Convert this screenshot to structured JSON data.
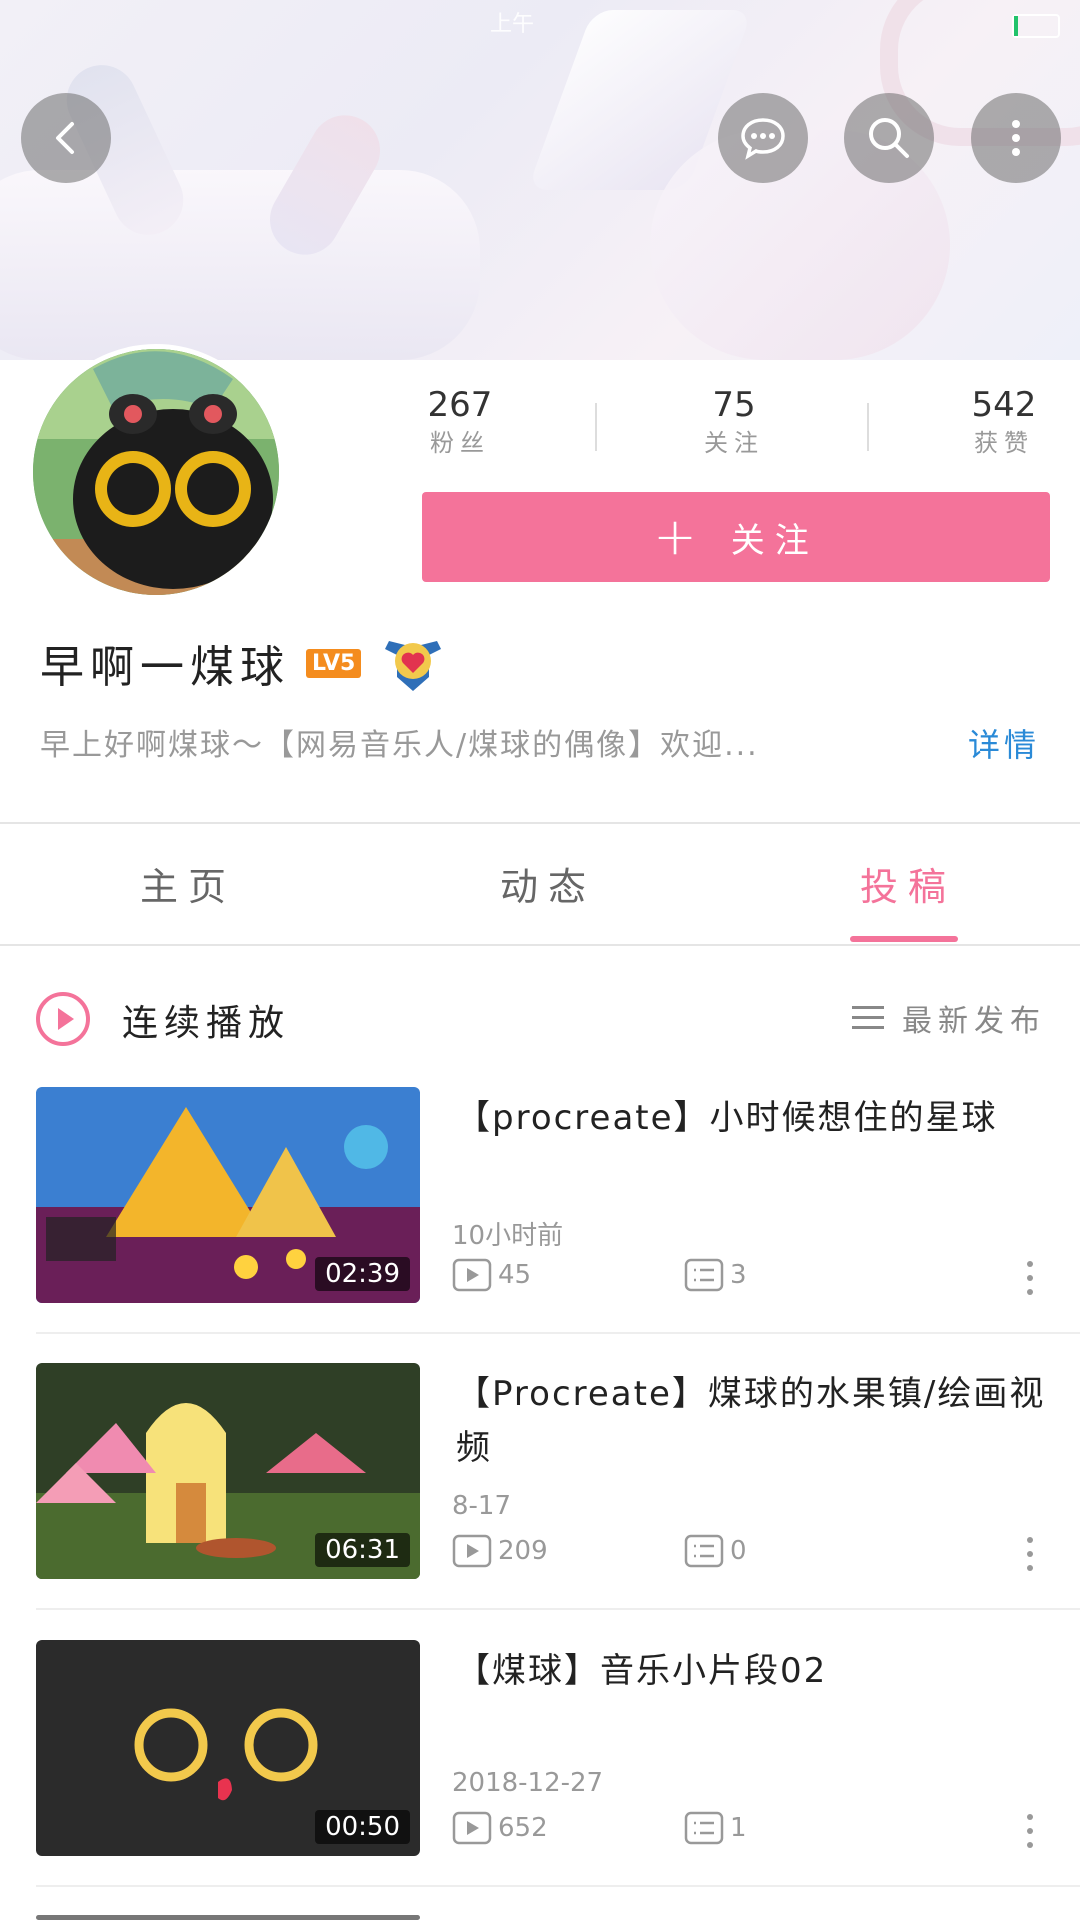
{
  "status_bar": {
    "time": "上午"
  },
  "colors": {
    "accent": "#f4739a",
    "link": "#2a8ad7",
    "level_badge": "#f48c1e"
  },
  "header": {
    "back_icon": "back-icon",
    "message_icon": "message-icon",
    "search_icon": "search-icon",
    "more_icon": "more-vertical-icon"
  },
  "profile": {
    "stats": [
      {
        "value": "267",
        "label": "粉丝"
      },
      {
        "value": "75",
        "label": "关注"
      },
      {
        "value": "542",
        "label": "获赞"
      }
    ],
    "follow_label": "关注",
    "name": "早啊一煤球",
    "level": "LV5",
    "bio": "早上好啊煤球～【网易音乐人/煤球的偶像】欢迎...",
    "detail_label": "详情"
  },
  "tabs": [
    {
      "label": "主页",
      "active": false
    },
    {
      "label": "动态",
      "active": false
    },
    {
      "label": "投稿",
      "active": true
    }
  ],
  "toolbar": {
    "continuous_play": "连续播放",
    "sort_label": "最新发布"
  },
  "videos": [
    {
      "title": "【procreate】小时候想住的星球",
      "time": "10小时前",
      "plays": "45",
      "danmaku": "3",
      "duration": "02:39"
    },
    {
      "title": "【Procreate】煤球的水果镇/绘画视频",
      "time": "8-17",
      "plays": "209",
      "danmaku": "0",
      "duration": "06:31"
    },
    {
      "title": "【煤球】音乐小片段02",
      "time": "2018-12-27",
      "plays": "652",
      "danmaku": "1",
      "duration": "00:50"
    }
  ]
}
